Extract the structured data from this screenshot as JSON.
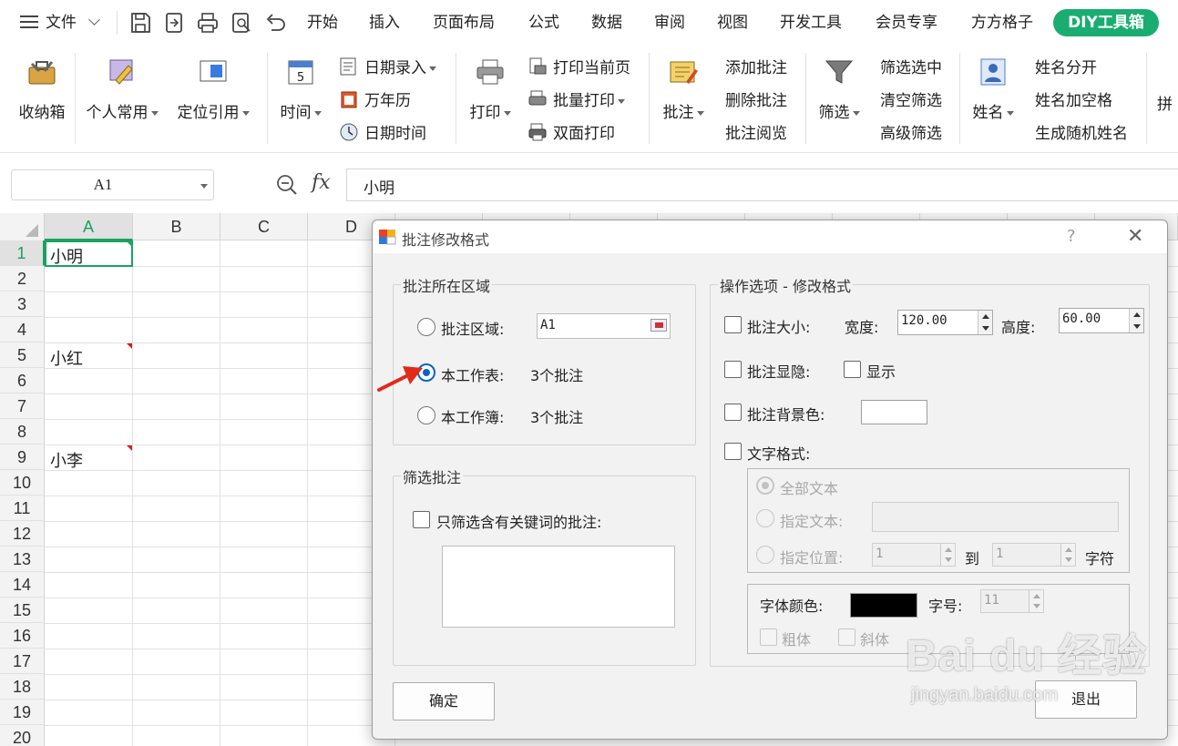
{
  "menubar": {
    "menu_label": "文件",
    "tabs": [
      "开始",
      "插入",
      "页面布局",
      "公式",
      "数据",
      "审阅",
      "视图",
      "开发工具",
      "会员专享",
      "方方格子"
    ],
    "active_tab": "DIY工具箱"
  },
  "ribbon": {
    "toolbox": "收纳箱",
    "personal": "个人常用",
    "locate": "定位引用",
    "time": "时间",
    "date_input": "日期录入",
    "calendar": "万年历",
    "datetime": "日期时间",
    "print": "打印",
    "print_current": "打印当前页",
    "batch_print": "批量打印",
    "duplex_print": "双面打印",
    "comment": "批注",
    "add_comment": "添加批注",
    "delete_comment": "删除批注",
    "view_comment": "批注阅览",
    "filter": "筛选",
    "filter_selected": "筛选选中",
    "clear_filter": "清空筛选",
    "advanced_filter": "高级筛选",
    "name": "姓名",
    "split_name": "姓名分开",
    "name_space": "姓名加空格",
    "random_name": "生成随机姓名",
    "pinyin_partial": "拼"
  },
  "formula_bar": {
    "cell_ref": "A1",
    "fx": "fx",
    "content": "小明"
  },
  "grid": {
    "columns": [
      "A",
      "B",
      "C",
      "D"
    ],
    "rows": [
      "1",
      "2",
      "3",
      "4",
      "5",
      "6",
      "7",
      "8",
      "9",
      "10",
      "11",
      "12",
      "13",
      "14",
      "15",
      "16",
      "17",
      "18",
      "19",
      "20"
    ],
    "cells": {
      "a1": "小明",
      "a5": "小红",
      "a9": "小李"
    }
  },
  "dialog": {
    "title": "批注修改格式",
    "help": "?",
    "close": "✕",
    "region_group": "批注所在区域",
    "region_range_label": "批注区域:",
    "region_range_value": "A1",
    "sheet_label": "本工作表:",
    "sheet_count": "3个批注",
    "workbook_label": "本工作簿:",
    "workbook_count": "3个批注",
    "filter_group": "筛选批注",
    "filter_keyword_label": "只筛选含有关键词的批注:",
    "options_group": "操作选项 - 修改格式",
    "size_label": "批注大小:",
    "width_label": "宽度:",
    "width_value": "120.00",
    "height_label": "高度:",
    "height_value": "60.00",
    "visibility_label": "批注显隐:",
    "show_label": "显示",
    "bg_label": "批注背景色:",
    "text_format_label": "文字格式:",
    "all_text": "全部文本",
    "specified_text": "指定文本:",
    "specified_pos": "指定位置:",
    "pos_from": "1",
    "to_label": "到",
    "pos_to": "1",
    "char_label": "字符",
    "font_color_label": "字体颜色:",
    "font_size_label": "字号:",
    "font_size_value": "11",
    "bold_label": "粗体",
    "italic_label": "斜体",
    "ok": "确定",
    "exit": "退出"
  },
  "colors": {
    "accent": "#1aad72",
    "radio_selected": "#0a63c6",
    "comment_marker": "#e0181b"
  },
  "watermark": {
    "brand": "Bai du 经验",
    "url": "jingyan.baidu.com"
  }
}
